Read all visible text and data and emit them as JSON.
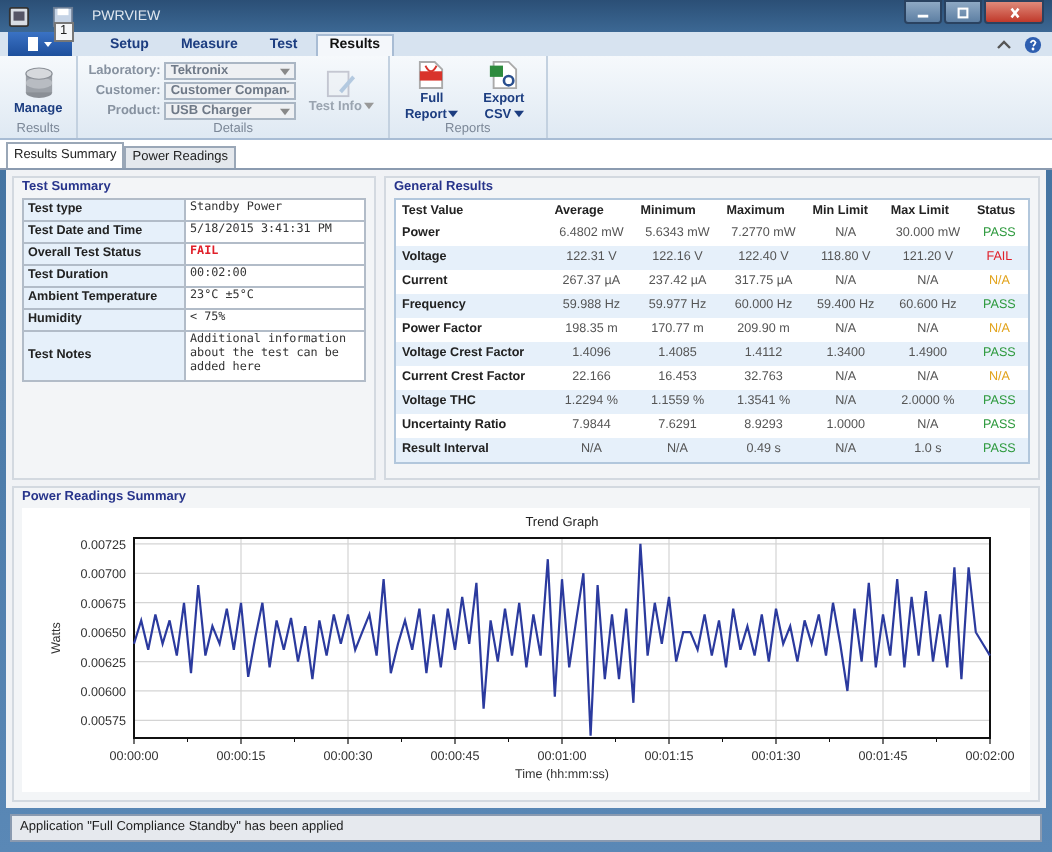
{
  "window": {
    "title": "PWRVIEW",
    "key_tip": "1"
  },
  "ribbon": {
    "tabs": [
      {
        "label": "Setup",
        "selected": false
      },
      {
        "label": "Measure",
        "selected": false
      },
      {
        "label": "Test",
        "selected": false
      },
      {
        "label": "Results",
        "selected": true
      }
    ],
    "results_group": {
      "label": "Results",
      "button": "Manage"
    },
    "details_group": {
      "label": "Details",
      "fields": [
        {
          "label": "Laboratory:",
          "value": "Tektronix",
          "disabled": true
        },
        {
          "label": "Customer:",
          "value": "Customer Compan",
          "disabled": true
        },
        {
          "label": "Product:",
          "value": "USB Charger",
          "disabled": true
        }
      ],
      "test_info": {
        "label": "Test Info",
        "disabled": true
      }
    },
    "reports_group": {
      "label": "Reports",
      "buttons": [
        {
          "kind": "pdf",
          "label": "Full Report"
        },
        {
          "kind": "csv",
          "label": "Export CSV"
        }
      ]
    }
  },
  "doc_tabs": [
    {
      "label": "Results Summary",
      "selected": true
    },
    {
      "label": "Power Readings",
      "selected": false
    }
  ],
  "test_summary": {
    "title": "Test Summary",
    "rows": [
      {
        "label": "Test type",
        "value": "Standby Power"
      },
      {
        "label": "Test Date and Time",
        "value": "5/18/2015 3:41:31 PM"
      },
      {
        "label": "Overall Test Status",
        "value": "FAIL",
        "color": "#e0202a"
      },
      {
        "label": "Test Duration",
        "value": "00:02:00"
      },
      {
        "label": "Ambient Temperature",
        "value": "23°C ±5°C"
      },
      {
        "label": "Humidity",
        "value": "< 75%"
      },
      {
        "label": "Test Notes",
        "value": "Additional information about the test can be added here"
      }
    ]
  },
  "general_results": {
    "title": "General Results",
    "columns": [
      "Test Value",
      "Average",
      "Minimum",
      "Maximum",
      "Min Limit",
      "Max Limit",
      "Status"
    ],
    "rows": [
      {
        "cells": [
          "Power",
          "6.4802 mW",
          "5.6343 mW",
          "7.2770 mW",
          "N/A",
          "30.000 mW"
        ],
        "status": {
          "text": "PASS",
          "color": "#2e9a3e"
        }
      },
      {
        "cells": [
          "Voltage",
          "122.31 V",
          "122.16 V",
          "122.40 V",
          "118.80 V",
          "121.20 V"
        ],
        "status": {
          "text": "FAIL",
          "color": "#e0202a"
        }
      },
      {
        "cells": [
          "Current",
          "267.37 µA",
          "237.42 µA",
          "317.75 µA",
          "N/A",
          "N/A"
        ],
        "status": {
          "text": "N/A",
          "color": "#e2a31c"
        }
      },
      {
        "cells": [
          "Frequency",
          "59.988 Hz",
          "59.977 Hz",
          "60.000 Hz",
          "59.400 Hz",
          "60.600 Hz"
        ],
        "status": {
          "text": "PASS",
          "color": "#2e9a3e"
        }
      },
      {
        "cells": [
          "Power Factor",
          "198.35 m",
          "170.77 m",
          "209.90 m",
          "N/A",
          "N/A"
        ],
        "status": {
          "text": "N/A",
          "color": "#e2a31c"
        }
      },
      {
        "cells": [
          "Voltage Crest Factor",
          "1.4096",
          "1.4085",
          "1.4112",
          "1.3400",
          "1.4900"
        ],
        "status": {
          "text": "PASS",
          "color": "#2e9a3e"
        }
      },
      {
        "cells": [
          "Current Crest Factor",
          "22.166",
          "16.453",
          "32.763",
          "N/A",
          "N/A"
        ],
        "status": {
          "text": "N/A",
          "color": "#e2a31c"
        }
      },
      {
        "cells": [
          "Voltage THC",
          "1.2294 %",
          "1.1559 %",
          "1.3541 %",
          "N/A",
          "2.0000 %"
        ],
        "status": {
          "text": "PASS",
          "color": "#2e9a3e"
        }
      },
      {
        "cells": [
          "Uncertainty Ratio",
          "7.9844",
          "7.6291",
          "8.9293",
          "1.0000",
          "N/A"
        ],
        "status": {
          "text": "PASS",
          "color": "#2e9a3e"
        }
      },
      {
        "cells": [
          "Result Interval",
          "N/A",
          "N/A",
          "0.49 s",
          "N/A",
          "1.0 s"
        ],
        "status": {
          "text": "PASS",
          "color": "#2e9a3e"
        }
      }
    ]
  },
  "power_readings": {
    "title": "Power Readings Summary",
    "chart_data": {
      "type": "line",
      "title": "Trend Graph",
      "xlabel": "Time (hh:mm:ss)",
      "ylabel": "Watts",
      "x": [
        0,
        1,
        2,
        3,
        4,
        5,
        6,
        7,
        8,
        9,
        10,
        11,
        12,
        13,
        14,
        15,
        16,
        17,
        18,
        19,
        20,
        21,
        22,
        23,
        24,
        25,
        26,
        27,
        28,
        29,
        30,
        31,
        32,
        33,
        34,
        35,
        36,
        37,
        38,
        39,
        40,
        41,
        42,
        43,
        44,
        45,
        46,
        47,
        48,
        49,
        50,
        51,
        52,
        53,
        54,
        55,
        56,
        57,
        58,
        59,
        60,
        61,
        62,
        63,
        64,
        65,
        66,
        67,
        68,
        69,
        70,
        71,
        72,
        73,
        74,
        75,
        76,
        77,
        78,
        79,
        80,
        81,
        82,
        83,
        84,
        85,
        86,
        87,
        88,
        89,
        90,
        91,
        92,
        93,
        94,
        95,
        96,
        97,
        98,
        99,
        100,
        101,
        102,
        103,
        104,
        105,
        106,
        107,
        108,
        109,
        110,
        111,
        112,
        113,
        114,
        115,
        116,
        117,
        118,
        119,
        120
      ],
      "series": [
        {
          "color": "#2b3a9e",
          "values": [
            0.0064,
            0.0066,
            0.00635,
            0.00665,
            0.0064,
            0.0066,
            0.0063,
            0.00675,
            0.00615,
            0.0069,
            0.0063,
            0.00655,
            0.0064,
            0.0067,
            0.00635,
            0.00675,
            0.00612,
            0.00645,
            0.00675,
            0.0062,
            0.0066,
            0.00635,
            0.00662,
            0.00625,
            0.00655,
            0.0061,
            0.0066,
            0.0063,
            0.00665,
            0.0064,
            0.00665,
            0.00635,
            0.0065,
            0.00665,
            0.0063,
            0.00695,
            0.00615,
            0.0064,
            0.0066,
            0.00635,
            0.0067,
            0.00615,
            0.00665,
            0.0062,
            0.0067,
            0.00635,
            0.0068,
            0.0064,
            0.00692,
            0.00585,
            0.0066,
            0.00625,
            0.0067,
            0.0063,
            0.00675,
            0.0062,
            0.00665,
            0.0063,
            0.00712,
            0.00595,
            0.00695,
            0.0062,
            0.0066,
            0.007,
            0.00562,
            0.0069,
            0.0061,
            0.00665,
            0.0061,
            0.0067,
            0.0059,
            0.00725,
            0.0063,
            0.00675,
            0.0064,
            0.0068,
            0.00625,
            0.0065,
            0.0065,
            0.00635,
            0.00665,
            0.0063,
            0.0066,
            0.0062,
            0.0067,
            0.00635,
            0.00655,
            0.0063,
            0.00665,
            0.00625,
            0.0067,
            0.0064,
            0.00655,
            0.00625,
            0.0066,
            0.0064,
            0.00665,
            0.0063,
            0.00675,
            0.0064,
            0.006,
            0.0067,
            0.00625,
            0.00692,
            0.0062,
            0.00665,
            0.0063,
            0.00695,
            0.0062,
            0.0068,
            0.0063,
            0.00685,
            0.00625,
            0.00665,
            0.0062,
            0.00705,
            0.0061,
            0.00705,
            0.0065,
            0.0064,
            0.0063
          ]
        }
      ],
      "grid": true,
      "xlim": [
        0,
        120
      ],
      "ylim": [
        0.0056,
        0.0073
      ],
      "xticks": [
        {
          "value": 0,
          "label": "00:00:00"
        },
        {
          "value": 15,
          "label": "00:00:15"
        },
        {
          "value": 30,
          "label": "00:00:30"
        },
        {
          "value": 45,
          "label": "00:00:45"
        },
        {
          "value": 60,
          "label": "00:01:00"
        },
        {
          "value": 75,
          "label": "00:01:15"
        },
        {
          "value": 90,
          "label": "00:01:30"
        },
        {
          "value": 105,
          "label": "00:01:45"
        },
        {
          "value": 120,
          "label": "00:02:00"
        }
      ],
      "yticks": [
        {
          "value": 0.00575,
          "label": "0.00575"
        },
        {
          "value": 0.006,
          "label": "0.00600"
        },
        {
          "value": 0.00625,
          "label": "0.00625"
        },
        {
          "value": 0.0065,
          "label": "0.00650"
        },
        {
          "value": 0.00675,
          "label": "0.00675"
        },
        {
          "value": 0.007,
          "label": "0.00700"
        },
        {
          "value": 0.00725,
          "label": "0.00725"
        }
      ]
    }
  },
  "status_bar": {
    "message": "Application \"Full Compliance Standby\" has been applied"
  }
}
